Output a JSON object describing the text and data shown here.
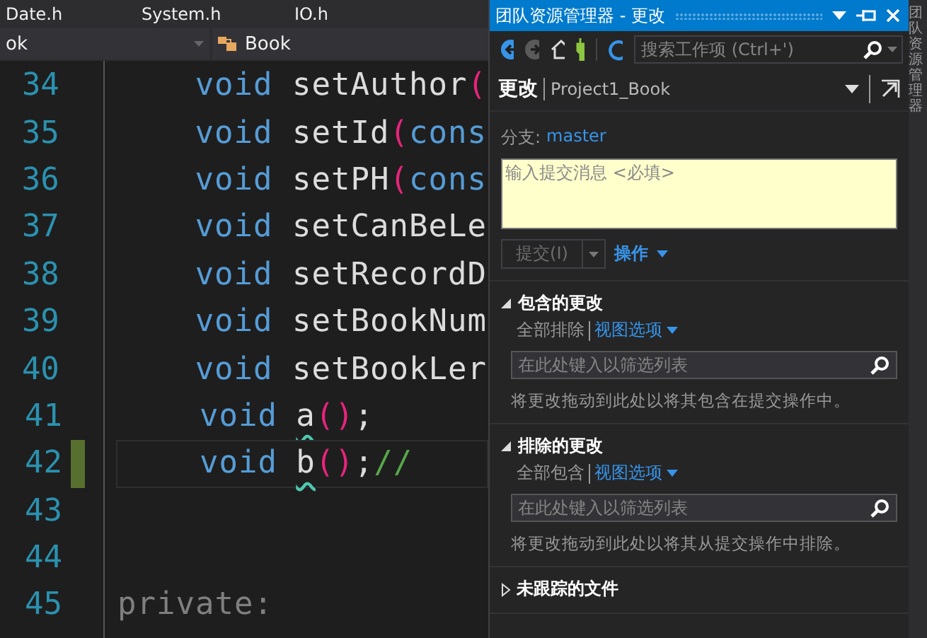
{
  "editor": {
    "tabs": [
      {
        "label": "Date.h"
      },
      {
        "label": "System.h"
      },
      {
        "label": "IO.h"
      }
    ],
    "scope_dropdown": {
      "value": "ok"
    },
    "member_dropdown": {
      "value": "Book"
    },
    "lines": [
      {
        "number": "34",
        "changed": false,
        "current": false,
        "tokens": [
          {
            "kind": "keyword",
            "text": "void"
          },
          {
            "kind": "plain",
            "text": " setAuthor"
          },
          {
            "kind": "paren",
            "text": "("
          }
        ]
      },
      {
        "number": "35",
        "changed": false,
        "current": false,
        "tokens": [
          {
            "kind": "keyword",
            "text": "void"
          },
          {
            "kind": "plain",
            "text": " setId"
          },
          {
            "kind": "paren",
            "text": "("
          },
          {
            "kind": "keyword",
            "text": "cons"
          }
        ]
      },
      {
        "number": "36",
        "changed": false,
        "current": false,
        "tokens": [
          {
            "kind": "keyword",
            "text": "void"
          },
          {
            "kind": "plain",
            "text": " setPH"
          },
          {
            "kind": "paren",
            "text": "("
          },
          {
            "kind": "keyword",
            "text": "cons"
          }
        ]
      },
      {
        "number": "37",
        "changed": false,
        "current": false,
        "tokens": [
          {
            "kind": "keyword",
            "text": "void"
          },
          {
            "kind": "plain",
            "text": " setCanBeLe"
          }
        ]
      },
      {
        "number": "38",
        "changed": false,
        "current": false,
        "tokens": [
          {
            "kind": "keyword",
            "text": "void"
          },
          {
            "kind": "plain",
            "text": " setRecordD"
          }
        ]
      },
      {
        "number": "39",
        "changed": false,
        "current": false,
        "tokens": [
          {
            "kind": "keyword",
            "text": "void"
          },
          {
            "kind": "plain",
            "text": " setBookNum"
          }
        ]
      },
      {
        "number": "40",
        "changed": false,
        "current": false,
        "tokens": [
          {
            "kind": "keyword",
            "text": "void"
          },
          {
            "kind": "plain",
            "text": " setBookLer"
          }
        ]
      },
      {
        "number": "41",
        "changed": false,
        "current": false,
        "tokens": [
          {
            "kind": "keyword",
            "text": "void"
          },
          {
            "kind": "error",
            "text": "a"
          },
          {
            "kind": "paren",
            "text": "()"
          },
          {
            "kind": "plain",
            "text": ";"
          }
        ]
      },
      {
        "number": "42",
        "changed": true,
        "current": true,
        "tokens": [
          {
            "kind": "keyword",
            "text": "void"
          },
          {
            "kind": "error",
            "text": "b"
          },
          {
            "kind": "paren",
            "text": "()"
          },
          {
            "kind": "plain",
            "text": ";"
          },
          {
            "kind": "comment",
            "text": "//"
          }
        ]
      },
      {
        "number": "43",
        "changed": false,
        "current": false
      },
      {
        "number": "44",
        "changed": false,
        "current": false
      },
      {
        "number": "45",
        "changed": false,
        "current": false,
        "tokens": [
          {
            "kind": "access",
            "text": "private:"
          }
        ]
      }
    ]
  },
  "team_explorer": {
    "title": "团队资源管理器 - 更改",
    "search": {
      "placeholder": "搜索工作项 (Ctrl+')"
    },
    "page_title": "更改",
    "project": "Project1_Book",
    "branch_label": "分支:",
    "branch": "master",
    "commit_message": {
      "placeholder": "输入提交消息 <必填>"
    },
    "commit_button": {
      "label": "提交(I)",
      "disabled": true
    },
    "actions_link": "操作",
    "sections": [
      {
        "kind": "list",
        "title": "包含的更改",
        "expanded": true,
        "action": "全部排除",
        "view_options": "视图选项",
        "filter_placeholder": "在此处键入以筛选列表",
        "hint": "将更改拖动到此处以将其包含在提交操作中。"
      },
      {
        "kind": "list",
        "title": "排除的更改",
        "expanded": true,
        "action": "全部包含",
        "view_options": "视图选项",
        "filter_placeholder": "在此处键入以筛选列表",
        "hint": "将更改拖动到此处以将其从提交操作中排除。"
      },
      {
        "kind": "list",
        "title": "未跟踪的文件",
        "expanded": false
      }
    ]
  },
  "side_rail": {
    "label": "团队资源管理器"
  }
}
